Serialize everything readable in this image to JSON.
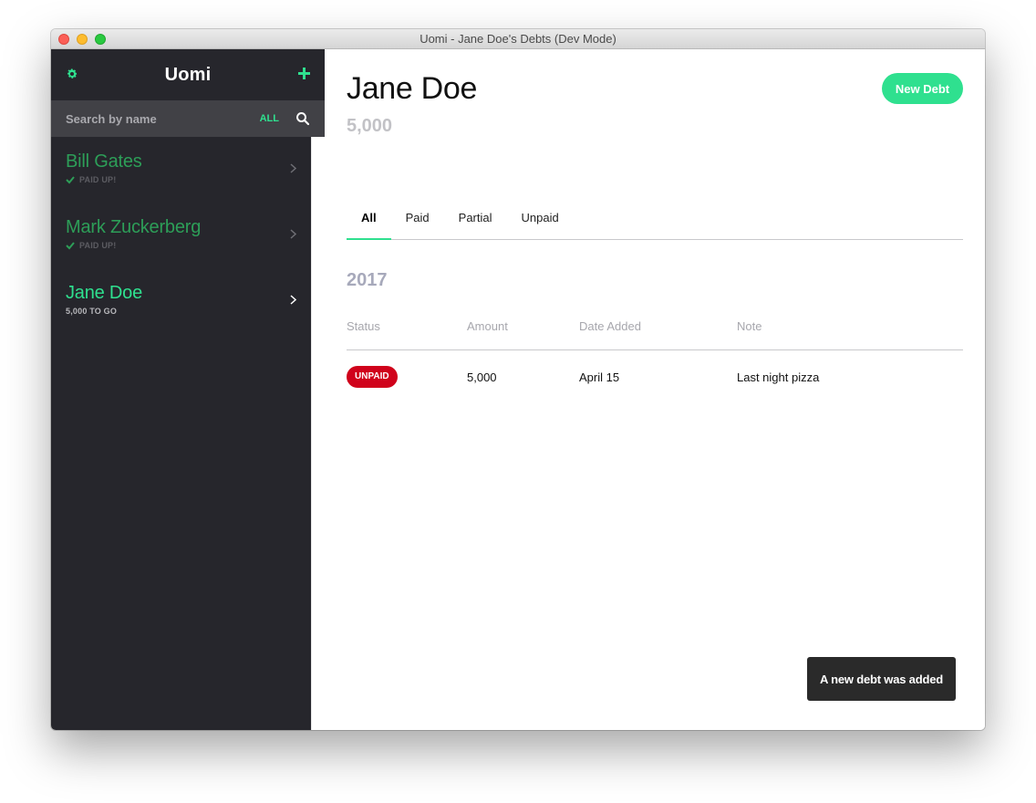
{
  "window": {
    "title": "Uomi - Jane Doe's Debts (Dev Mode)"
  },
  "sidebar": {
    "app_title": "Uomi",
    "search": {
      "placeholder": "Search by name",
      "filter": "ALL"
    },
    "items": [
      {
        "name": "Bill Gates",
        "status": "PAID UP!",
        "state": "paid"
      },
      {
        "name": "Mark Zuckerberg",
        "status": "PAID UP!",
        "state": "paid"
      },
      {
        "name": "Jane Doe",
        "status": "5,000 TO GO",
        "state": "active"
      }
    ]
  },
  "main": {
    "person_name": "Jane Doe",
    "total_amount": "5,000",
    "new_debt_label": "New Debt",
    "tabs": [
      {
        "label": "All",
        "active": true
      },
      {
        "label": "Paid",
        "active": false
      },
      {
        "label": "Partial",
        "active": false
      },
      {
        "label": "Unpaid",
        "active": false
      }
    ],
    "year": "2017",
    "table": {
      "headers": [
        "Status",
        "Amount",
        "Date Added",
        "Note"
      ],
      "rows": [
        {
          "status": "UNPAID",
          "amount": "5,000",
          "date": "April 15",
          "note": "Last night pizza"
        }
      ]
    },
    "toast": "A new debt was added"
  },
  "colors": {
    "accent": "#2fe08f",
    "sidebar_bg": "#26262c",
    "unpaid_badge": "#d0021b",
    "paid_name": "#2d9e58"
  },
  "icons": [
    "gear-icon",
    "plus-icon",
    "search-icon",
    "check-icon",
    "chevron-right-icon"
  ]
}
